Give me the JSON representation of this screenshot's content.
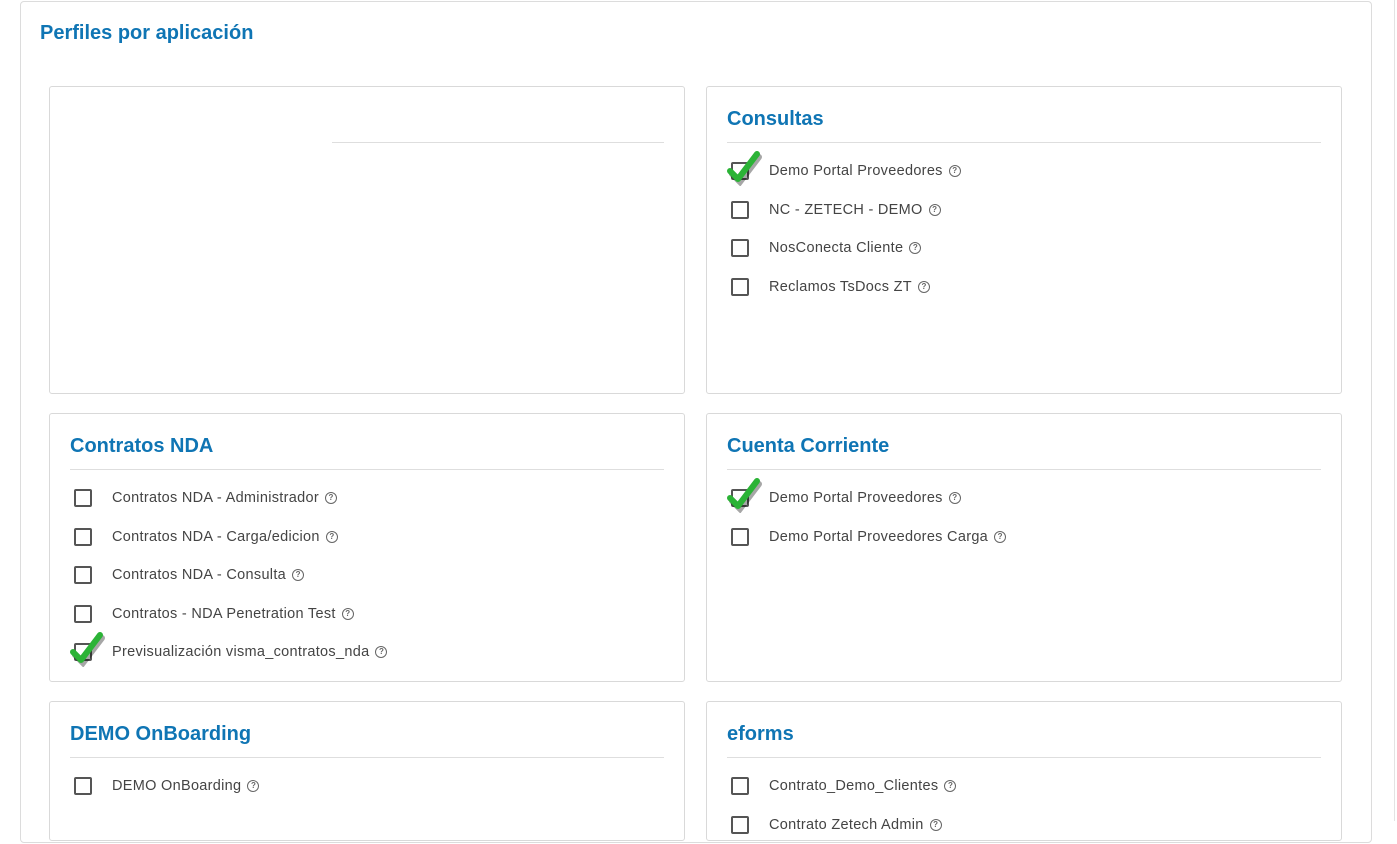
{
  "page": {
    "title": "Perfiles por aplicación"
  },
  "cards": {
    "empty": {
      "title": ""
    },
    "consultas": {
      "title": "Consultas",
      "items": [
        {
          "label": "Demo Portal Proveedores",
          "checked": true
        },
        {
          "label": "NC - ZETECH - DEMO",
          "checked": false
        },
        {
          "label": "NosConecta Cliente",
          "checked": false
        },
        {
          "label": "Reclamos TsDocs ZT",
          "checked": false
        }
      ]
    },
    "contratos": {
      "title": "Contratos NDA",
      "items": [
        {
          "label": "Contratos NDA - Administrador",
          "checked": false
        },
        {
          "label": "Contratos NDA - Carga/edicion",
          "checked": false
        },
        {
          "label": "Contratos NDA - Consulta",
          "checked": false
        },
        {
          "label": "Contratos - NDA Penetration Test",
          "checked": false
        },
        {
          "label": "Previsualización visma_contratos_nda",
          "checked": true
        }
      ]
    },
    "cuenta": {
      "title": "Cuenta Corriente",
      "items": [
        {
          "label": "Demo Portal Proveedores",
          "checked": true
        },
        {
          "label": "Demo Portal Proveedores Carga",
          "checked": false
        }
      ]
    },
    "onboarding": {
      "title": "DEMO OnBoarding",
      "items": [
        {
          "label": "DEMO OnBoarding",
          "checked": false
        }
      ]
    },
    "eforms": {
      "title": "eforms",
      "items": [
        {
          "label": "Contrato_Demo_Clientes",
          "checked": false
        },
        {
          "label": "Contrato Zetech Admin",
          "checked": false
        }
      ]
    }
  },
  "icons": {
    "help": "question-circle-icon",
    "check": "green-checkmark-icon"
  },
  "colors": {
    "accent": "#0f75b4",
    "check_green": "#2bb336"
  },
  "help_glyph": "?"
}
